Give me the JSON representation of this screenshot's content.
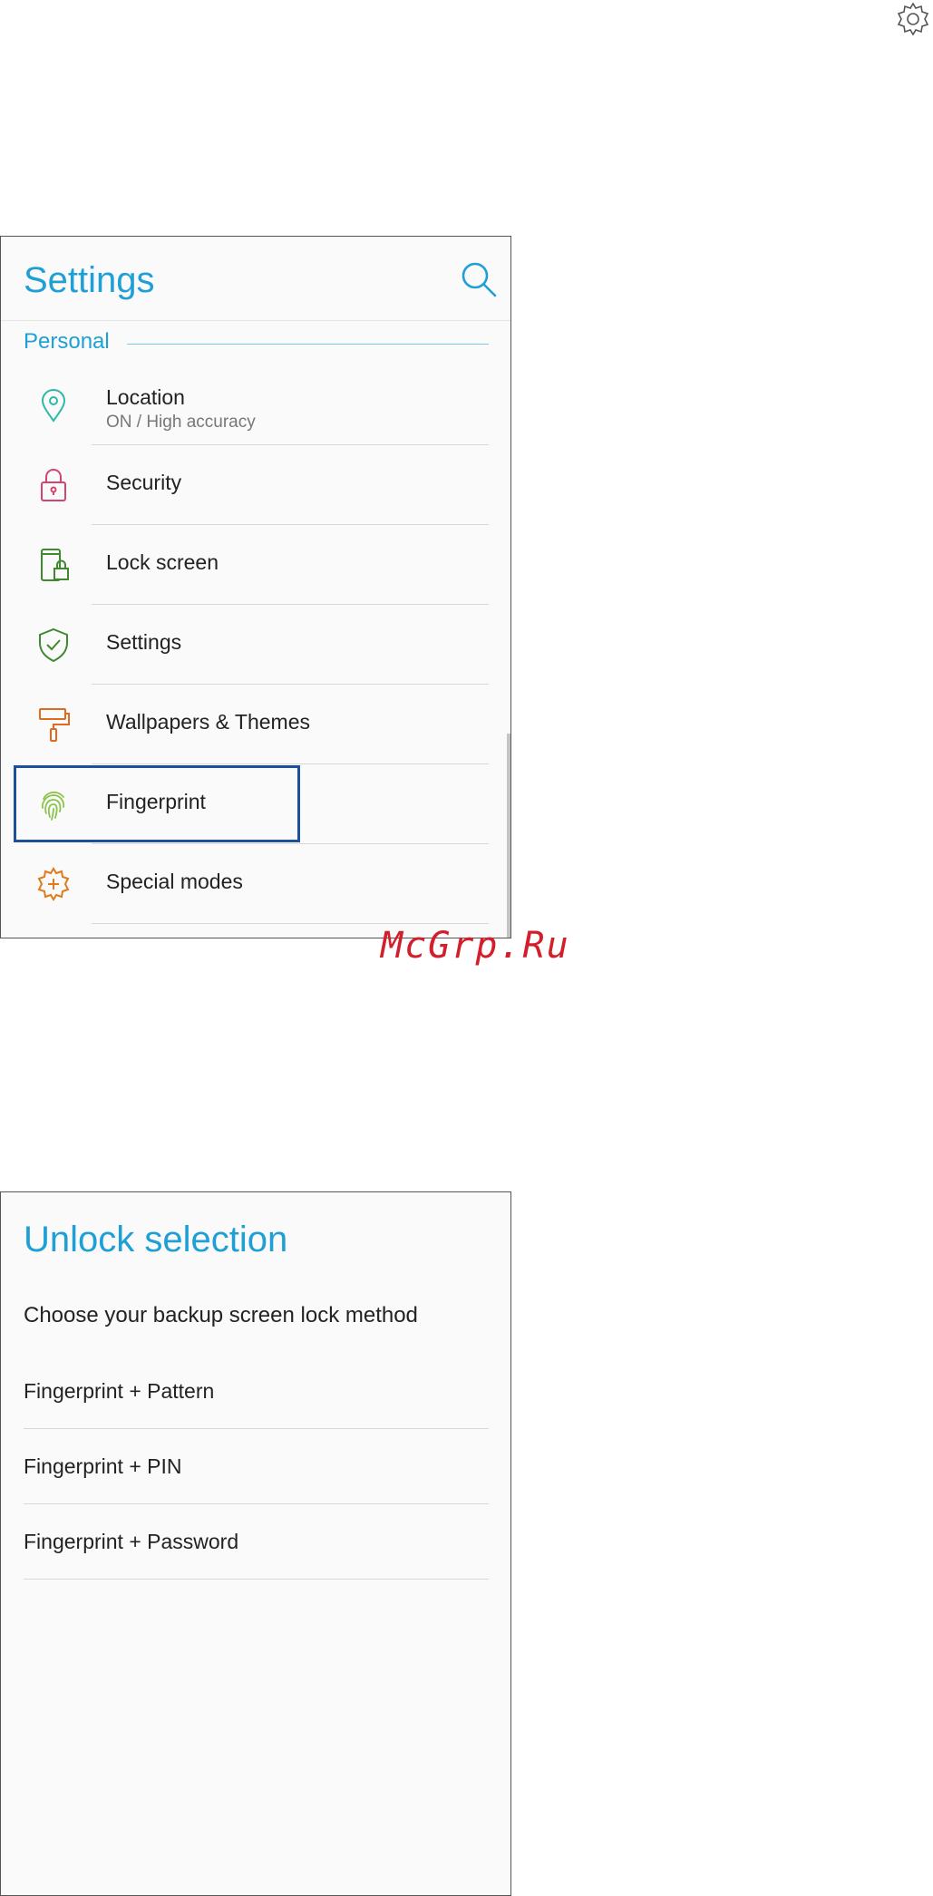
{
  "corner_icon": "gear-icon",
  "settings": {
    "title": "Settings",
    "search_icon": "search-icon",
    "section_label": "Personal",
    "items": [
      {
        "label": "Location",
        "sub": "ON / High accuracy",
        "icon": "location-pin-icon",
        "color": "#2fb8a8"
      },
      {
        "label": "Security",
        "icon": "lock-icon",
        "color": "#d2456f"
      },
      {
        "label": "Lock screen",
        "icon": "phone-lock-icon",
        "color": "#3f8a2e"
      },
      {
        "label": "Settings",
        "icon": "shield-check-icon",
        "color": "#3f8a2e"
      },
      {
        "label": "Wallpapers & Themes",
        "icon": "paint-roller-icon",
        "color": "#e06a1f"
      },
      {
        "label": "Fingerprint",
        "icon": "fingerprint-icon",
        "color": "#8bc34a"
      },
      {
        "label": "Special modes",
        "icon": "gear-plus-icon",
        "color": "#e07a1f"
      }
    ]
  },
  "watermark": "McGrp.Ru",
  "unlock": {
    "title": "Unlock selection",
    "subtitle": "Choose your backup screen lock method",
    "options": [
      {
        "label": "Fingerprint + Pattern"
      },
      {
        "label": "Fingerprint + PIN"
      },
      {
        "label": "Fingerprint + Password"
      }
    ]
  },
  "colors": {
    "accent": "#1ea0d6",
    "highlight": "#1c4f9c",
    "watermark": "#d21f2b"
  }
}
